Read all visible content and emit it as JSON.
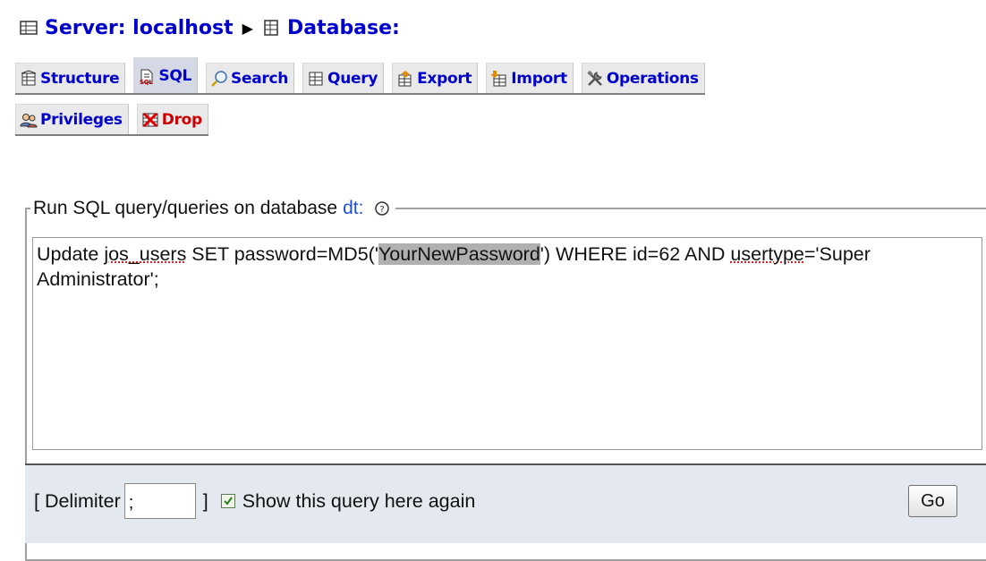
{
  "breadcrumb": {
    "server_label": "Server: localhost",
    "separator": "▶",
    "database_label": "Database:"
  },
  "tabs_row1": [
    {
      "label": "Structure",
      "icon": "structure-icon"
    },
    {
      "label": "SQL",
      "icon": "sql-icon",
      "active": true
    },
    {
      "label": "Search",
      "icon": "search-icon"
    },
    {
      "label": "Query",
      "icon": "query-icon"
    },
    {
      "label": "Export",
      "icon": "export-icon"
    },
    {
      "label": "Import",
      "icon": "import-icon"
    },
    {
      "label": "Operations",
      "icon": "operations-icon"
    }
  ],
  "tabs_row2": [
    {
      "label": "Privileges",
      "icon": "privileges-icon"
    },
    {
      "label": "Drop",
      "icon": "drop-icon"
    }
  ],
  "query_panel": {
    "legend_prefix": "Run SQL query/queries on database",
    "database_name": "dt:",
    "sql_part1": "Update ",
    "sql_table": "jos_users",
    "sql_part2": " SET password=MD5('",
    "sql_selected": "YourNewPassword",
    "sql_part3": "') WHERE id=62 AND ",
    "sql_column": "usertype",
    "sql_part4": "='Super Administrator';"
  },
  "footer": {
    "delimiter_prefix": "[ Delimiter",
    "delimiter_value": ";",
    "delimiter_suffix": "]",
    "show_again_label": "Show this query here again",
    "show_again_checked": true,
    "go_label": "Go"
  },
  "colors": {
    "link": "#0000cc",
    "drop": "#cc0000",
    "active_tab": "#d5d9e6",
    "bottom_bar": "#e4e8ef"
  }
}
